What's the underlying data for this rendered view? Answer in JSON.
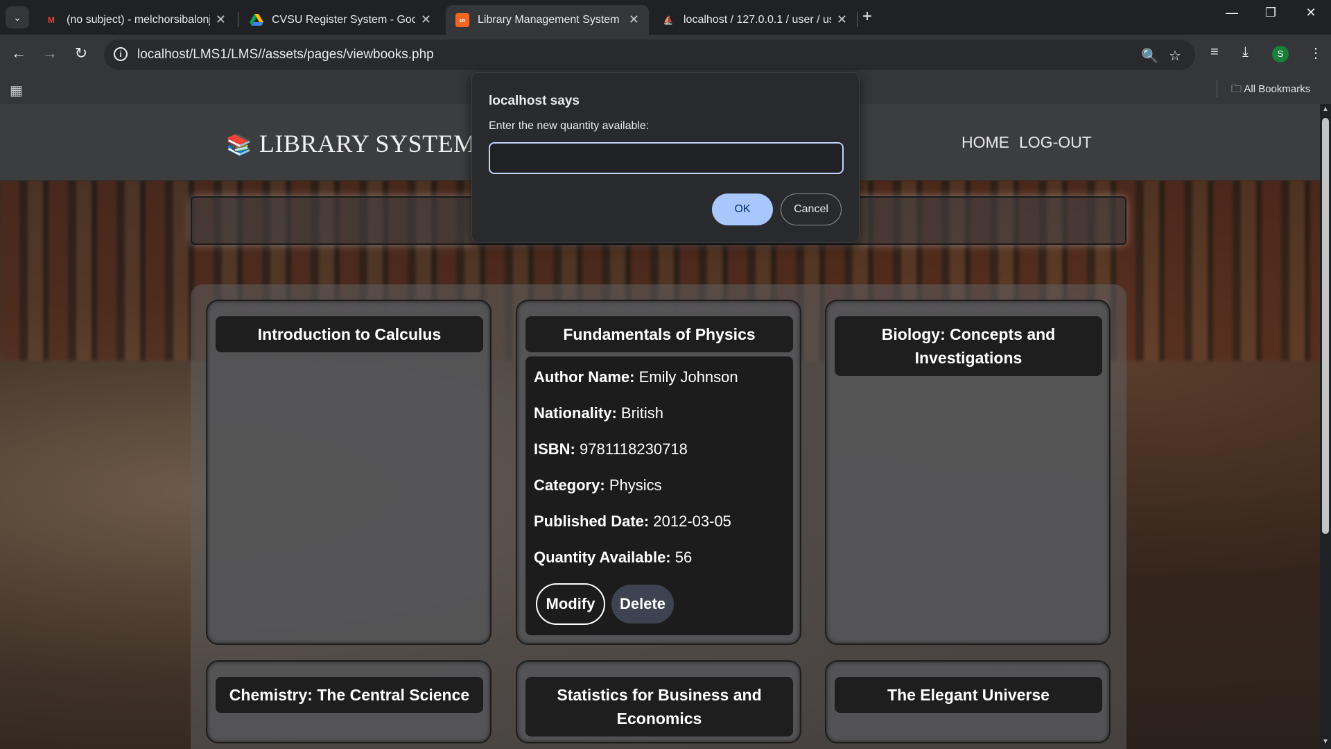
{
  "browser": {
    "tabs": [
      {
        "title": "(no subject) - melchorsibalonjr2",
        "favicon": "gmail-icon"
      },
      {
        "title": "CVSU Register System - Google",
        "favicon": "google-drive-icon"
      },
      {
        "title": "Library Management System",
        "favicon": "site-icon",
        "active": true
      },
      {
        "title": "localhost / 127.0.0.1 / user / use",
        "favicon": "phpmyadmin-icon"
      }
    ],
    "url": "localhost/LMS1/LMS//assets/pages/viewbooks.php",
    "profile_initial": "S",
    "bookmarks_label": "All Bookmarks"
  },
  "site": {
    "logo_text": "LIBRARY SYSTEM",
    "nav": {
      "home": "HOME",
      "logout": "LOG-OUT"
    }
  },
  "books": [
    {
      "title": "Introduction to Calculus"
    },
    {
      "title": "Fundamentals of Physics",
      "details": [
        {
          "label": "Author Name:",
          "value": "Emily Johnson"
        },
        {
          "label": "Nationality:",
          "value": "British"
        },
        {
          "label": "ISBN:",
          "value": "9781118230718"
        },
        {
          "label": "Category:",
          "value": "Physics"
        },
        {
          "label": "Published Date:",
          "value": "2012-03-05"
        },
        {
          "label": "Quantity Available:",
          "value": "56"
        }
      ],
      "modify_label": "Modify",
      "delete_label": "Delete"
    },
    {
      "title": "Biology: Concepts and Investigations"
    },
    {
      "title": "Chemistry: The Central Science"
    },
    {
      "title": "Statistics for Business and Economics"
    },
    {
      "title": "The Elegant Universe"
    }
  ],
  "dialog": {
    "title": "localhost says",
    "message": "Enter the new quantity available:",
    "input_value": "",
    "ok_label": "OK",
    "cancel_label": "Cancel"
  },
  "colors": {
    "header_bg": "#3c3d3f",
    "dialog_ok": "#a8c7fa",
    "card_title_bg": "#1e1e1f"
  }
}
